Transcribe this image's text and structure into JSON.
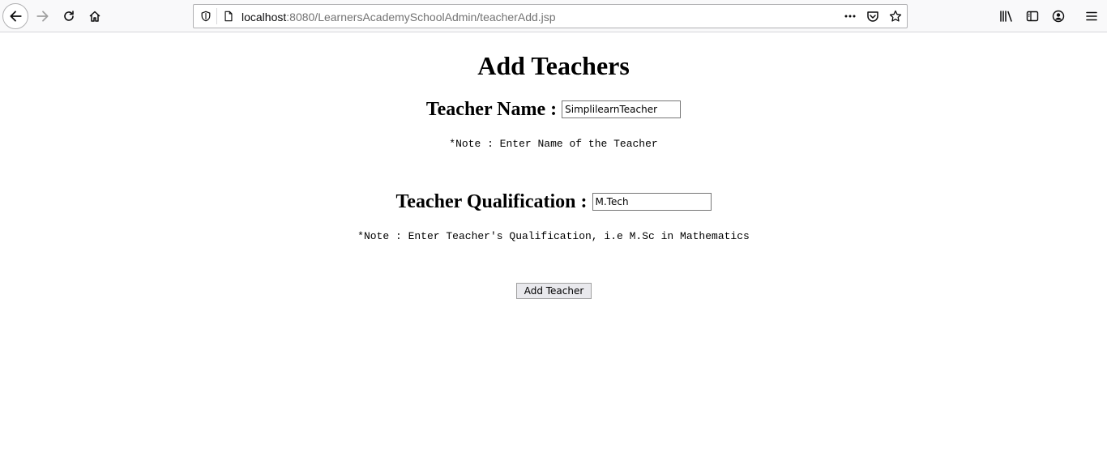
{
  "browser": {
    "url_host": "localhost",
    "url_path": ":8080/LearnersAcademySchoolAdmin/teacherAdd.jsp",
    "icons": [
      "back-icon",
      "forward-icon",
      "reload-icon",
      "home-icon",
      "shield-icon",
      "page-icon",
      "more-icon",
      "pocket-icon",
      "star-icon",
      "library-icon",
      "sidebar-icon",
      "account-icon",
      "menu-icon"
    ]
  },
  "page": {
    "title": "Add Teachers",
    "name_field": {
      "label": "Teacher Name :",
      "value": "SimplilearnTeacher",
      "note": "*Note : Enter Name of the Teacher"
    },
    "qualification_field": {
      "label": "Teacher Qualification :",
      "value": "M.Tech",
      "note": "*Note : Enter Teacher's Qualification, i.e M.Sc in Mathematics"
    },
    "submit_label": "Add Teacher"
  }
}
